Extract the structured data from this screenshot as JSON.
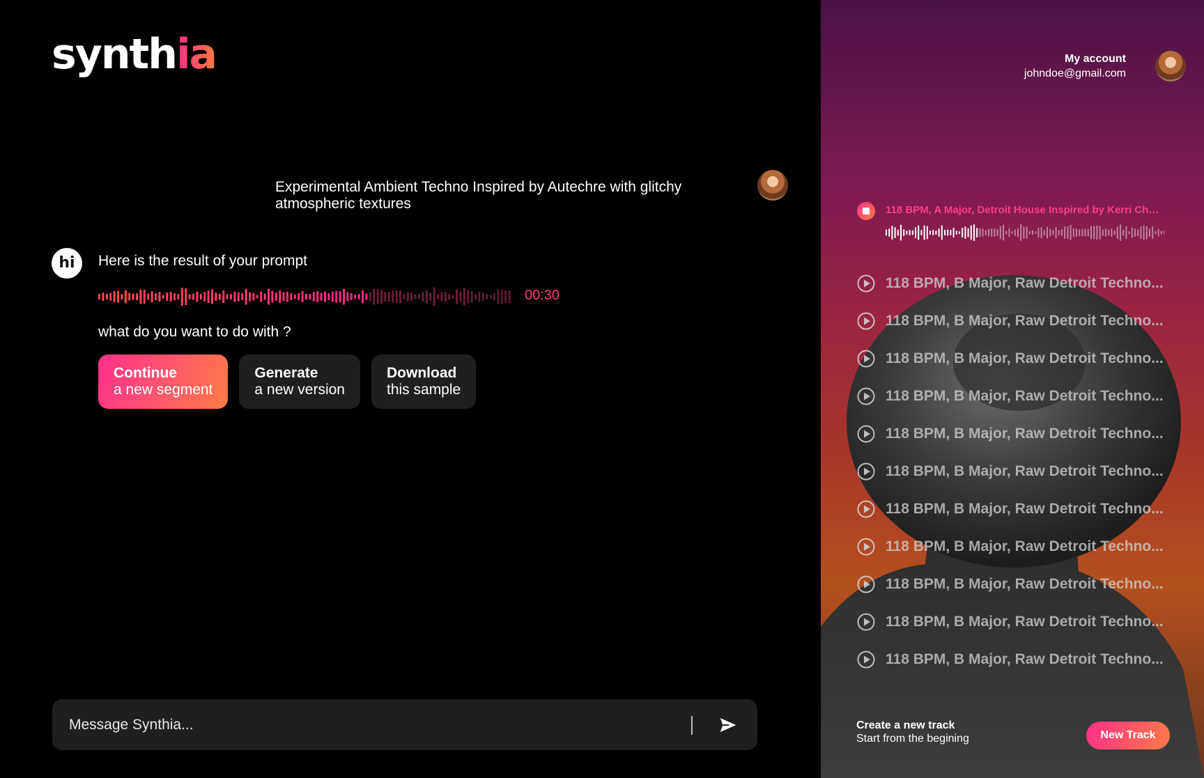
{
  "app": {
    "logo_main": "synth",
    "logo_accent": "ia"
  },
  "conversation": {
    "user_prompt": "Experimental Ambient Techno Inspired by Autechre with glitchy atmospheric textures",
    "bot_avatar_text": "hi",
    "bot_reply": "Here is the result of your prompt",
    "duration": "00:30",
    "playback_progress": 0.65,
    "question": "what do you want to do with ?",
    "actions": [
      {
        "title": "Continue",
        "subtitle": "a new segment"
      },
      {
        "title": "Generate",
        "subtitle": "a new version"
      },
      {
        "title": "Download",
        "subtitle": "this sample"
      }
    ]
  },
  "composer": {
    "placeholder": "Message Synthia..."
  },
  "account": {
    "label": "My account",
    "email": "johndoe@gmail.com"
  },
  "now_playing": {
    "title": "118 BPM, A Major, Detroit House Inspired by Kerri Chan...",
    "progress": 0.33
  },
  "tracks": [
    "118 BPM, B Major, Raw Detroit Techno...",
    "118 BPM, B Major, Raw Detroit Techno...",
    "118 BPM, B Major, Raw Detroit Techno...",
    "118 BPM, B Major, Raw Detroit Techno...",
    "118 BPM, B Major, Raw Detroit Techno...",
    "118 BPM, B Major, Raw Detroit Techno...",
    "118 BPM, B Major, Raw Detroit Techno...",
    "118 BPM, B Major, Raw Detroit Techno...",
    "118 BPM, B Major, Raw Detroit Techno...",
    "118 BPM, B Major, Raw Detroit Techno...",
    "118 BPM, B Major, Raw Detroit Techno..."
  ],
  "create": {
    "heading": "Create a new track",
    "subtext": "Start from the begining",
    "button": "New Track"
  },
  "colors": {
    "accent_pink": "#ff2f8a",
    "accent_orange": "#ff7b45",
    "background": "#000000",
    "surface": "#1f1f1f"
  }
}
